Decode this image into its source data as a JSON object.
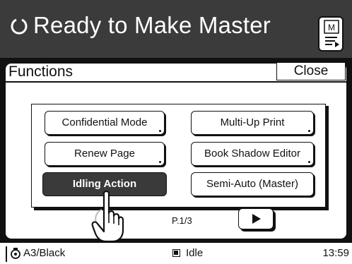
{
  "header": {
    "title": "Ready to Make Master",
    "status_icon": "refresh-arc-icon",
    "master_button_letter": "M"
  },
  "panel": {
    "title": "Functions",
    "close_label": "Close"
  },
  "functions": [
    {
      "label": "Confidential Mode",
      "active": false
    },
    {
      "label": "Multi-Up Print",
      "active": false
    },
    {
      "label": "Renew Page",
      "active": false
    },
    {
      "label": "Book Shadow Editor",
      "active": false
    },
    {
      "label": "Idling Action",
      "active": true
    },
    {
      "label": "Semi-Auto (Master)",
      "active": false
    }
  ],
  "pager": {
    "page_indicator": "P.1/3"
  },
  "statusbar": {
    "paper": "A3/Black",
    "state": "Idle",
    "time": "13:59"
  },
  "colors": {
    "header_bg": "#3b3b3b",
    "active_button_bg": "#3a3a3a",
    "outline": "#111111"
  }
}
